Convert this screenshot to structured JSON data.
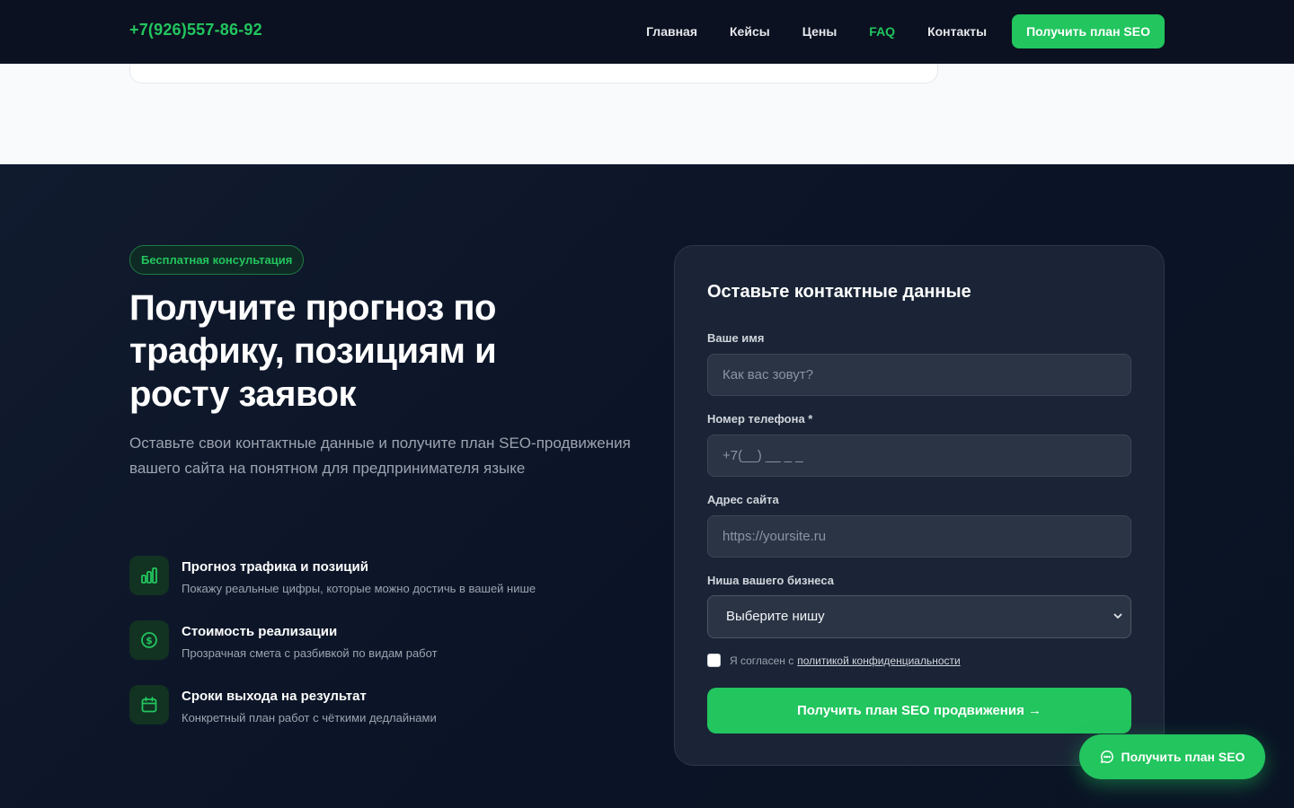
{
  "header": {
    "phone": "+7(926)557-86-92",
    "nav": [
      "Главная",
      "Кейсы",
      "Цены",
      "FAQ",
      "Контакты"
    ],
    "active_nav": "FAQ",
    "cta_label": "Получить план SEO"
  },
  "hero": {
    "badge": "Бесплатная консультация",
    "title": "Получите прогноз по трафику, позициям и росту заявок",
    "lead": "Оставьте свои контактные данные и получите план SEO-продвижения вашего сайта на понятном для предпринимателя языке"
  },
  "features": [
    {
      "icon": "bar-chart-icon",
      "title": "Прогноз трафика и позиций",
      "desc": "Покажу реальные цифры, которые можно достичь в вашей нише"
    },
    {
      "icon": "dollar-circle-icon",
      "title": "Стоимость реализации",
      "desc": "Прозрачная смета с разбивкой по видам работ"
    },
    {
      "icon": "calendar-icon",
      "title": "Сроки выхода на результат",
      "desc": "Конкретный план работ с чёткими дедлайнами"
    }
  ],
  "form": {
    "title": "Оставьте контактные данные",
    "name_label": "Ваше имя",
    "name_placeholder": "Как вас зовут?",
    "phone_label": "Номер телефона *",
    "phone_placeholder": "+7(__) __ _ _",
    "site_label": "Адрес сайта",
    "site_placeholder": "https://yoursite.ru",
    "niche_label": "Ниша вашего бизнеса",
    "niche_selected": "Выберите нишу",
    "consent_text": "Я согласен с",
    "consent_link": "политикой конфиденциальности",
    "submit_label": "Получить план SEO продвижения →"
  },
  "floating_cta": {
    "label": "Получить план SEO",
    "icon": "chat-icon"
  },
  "colors": {
    "accent": "#22c55e",
    "header_bg": "#0b1120",
    "section_bg": "#0f1a2e",
    "card_bg": "#1a2436"
  }
}
